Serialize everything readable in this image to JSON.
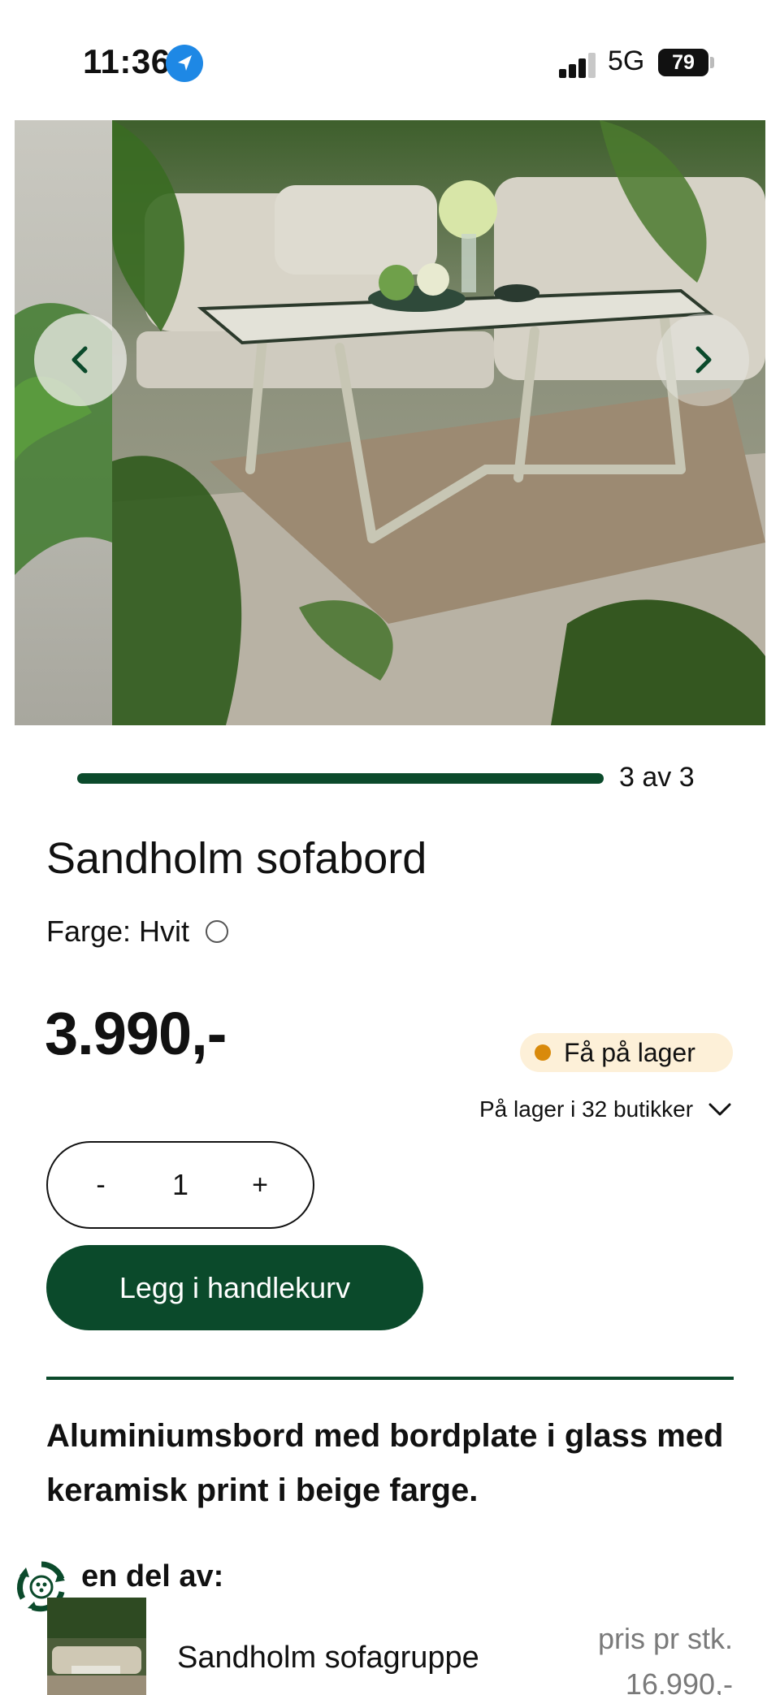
{
  "status_bar": {
    "time": "11:36",
    "network": "5G",
    "battery": "79"
  },
  "gallery": {
    "current": 3,
    "total": 3,
    "counter_label": "3 av 3",
    "progress_fraction": 1.0
  },
  "product": {
    "title": "Sandholm sofabord",
    "color_label": "Farge: Hvit",
    "price": "3.990,-",
    "stock_status": "Få på lager",
    "stores_label": "På lager i 32 butikker",
    "quantity": "1",
    "decrement_label": "-",
    "increment_label": "+",
    "add_to_cart_label": "Legg i handlekurv",
    "description": "Aluminiumsbord med bordplate i glass med keramisk print i beige farge."
  },
  "part_of": {
    "label": "en del av:",
    "item_name": "Sandholm sofagruppe",
    "unit_label": "pris pr stk.",
    "item_price": "16.990,-"
  },
  "colors": {
    "brand_green": "#0b4a2b",
    "stock_dot": "#d98a0b",
    "stock_badge_bg": "#fdf0d8",
    "location_blue": "#1e88e5"
  },
  "icons": {
    "location": "location-arrow-icon",
    "signal": "cellular-signal-icon",
    "battery": "battery-icon",
    "prev": "chevron-left-icon",
    "next": "chevron-right-icon",
    "stores": "chevron-down-icon",
    "part_of": "recycle-eco-icon"
  }
}
